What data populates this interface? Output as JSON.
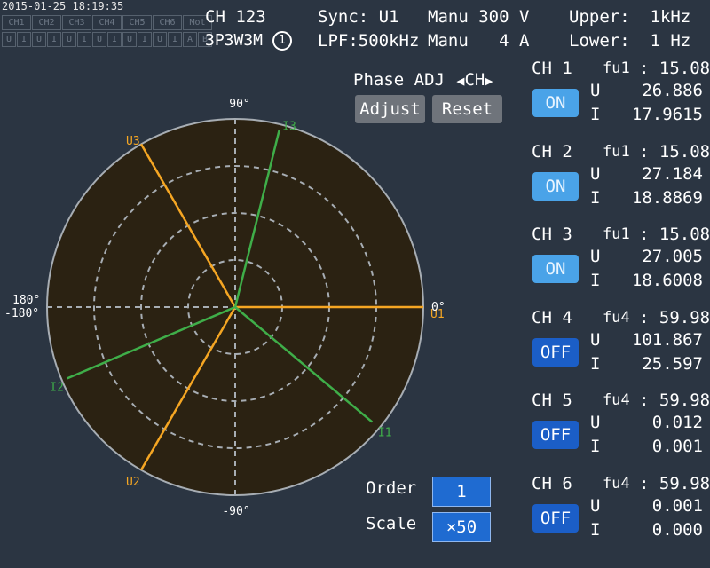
{
  "header": {
    "datetime": "2015-01-25 18:19:35",
    "channel_tabs": [
      "CH1",
      "CH2",
      "CH3",
      "CH4",
      "CH5",
      "CH6",
      "Mot"
    ],
    "input_tabs": [
      "U",
      "I",
      "U",
      "I",
      "U",
      "I",
      "U",
      "I",
      "U",
      "I",
      "U",
      "I",
      "A",
      "B"
    ],
    "channel_group": "CH 123",
    "wiring": "3P3W3M",
    "wiring_index": "1",
    "sync": "Sync: U1",
    "lpf": "LPF:500kHz",
    "voltage_range": "Manu 300 V",
    "current_range": "Manu   4 A",
    "upper": "Upper:  1kHz  1",
    "lower": "Lower:  1 Hz"
  },
  "phase_panel": {
    "title": "Phase ADJ",
    "ch_label": "CH",
    "adjust_label": "Adjust",
    "reset_label": "Reset",
    "order_label": "Order",
    "order_value": "1",
    "scale_label": "Scale",
    "scale_value": "×50"
  },
  "vector_plot": {
    "angle_labels": {
      "top": "90°",
      "bottom": "-90°",
      "right": "0°",
      "left_top": "180°",
      "left_bottom": "-180°"
    },
    "vectors": [
      {
        "name": "U1",
        "angle_deg": 0,
        "magnitude": 1.0,
        "color": "#f5a623"
      },
      {
        "name": "U2",
        "angle_deg": -120,
        "magnitude": 1.0,
        "color": "#f5a623"
      },
      {
        "name": "U3",
        "angle_deg": 120,
        "magnitude": 1.0,
        "color": "#f5a623"
      },
      {
        "name": "I1",
        "angle_deg": -40,
        "magnitude": 0.95,
        "color": "#3fae49"
      },
      {
        "name": "I2",
        "angle_deg": -157,
        "magnitude": 0.97,
        "color": "#3fae49"
      },
      {
        "name": "I3",
        "angle_deg": 76,
        "magnitude": 0.97,
        "color": "#3fae49"
      }
    ],
    "colors": {
      "background": "#2b2212",
      "grid": "#9aa0a6",
      "voltage": "#f5a623",
      "current": "#3fae49"
    }
  },
  "channels": [
    {
      "name": "CH 1",
      "fu": "fu1",
      "freq": ": 15.08",
      "state": "ON",
      "u": "26.886",
      "i": "17.9615"
    },
    {
      "name": "CH 2",
      "fu": "fu1",
      "freq": ": 15.08",
      "state": "ON",
      "u": "27.184",
      "i": "18.8869"
    },
    {
      "name": "CH 3",
      "fu": "fu1",
      "freq": ": 15.08",
      "state": "ON",
      "u": "27.005",
      "i": "18.6008"
    },
    {
      "name": "CH 4",
      "fu": "fu4",
      "freq": ": 59.98",
      "state": "OFF",
      "u": "101.867",
      "i": "25.597"
    },
    {
      "name": "CH 5",
      "fu": "fu4",
      "freq": ": 59.98",
      "state": "OFF",
      "u": "0.012",
      "i": "0.001"
    },
    {
      "name": "CH 6",
      "fu": "fu4",
      "freq": ": 59.98",
      "state": "OFF",
      "u": "0.001",
      "i": "0.000"
    }
  ]
}
